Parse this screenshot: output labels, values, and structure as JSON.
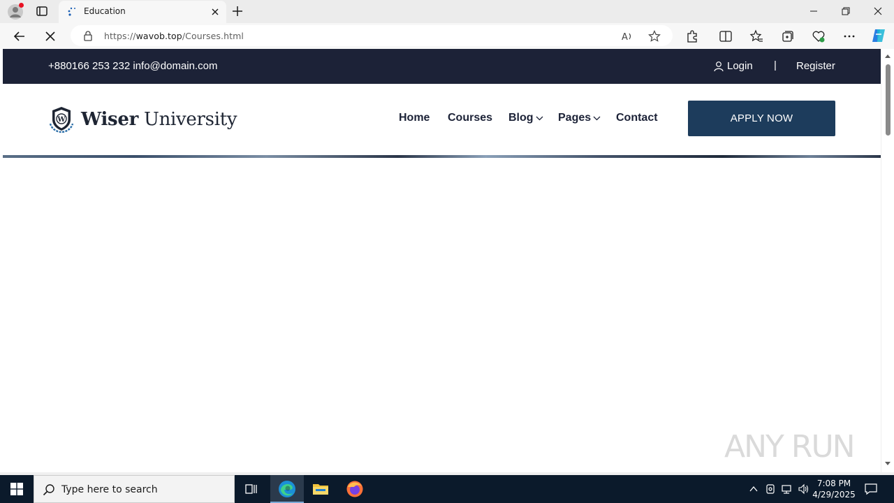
{
  "browser": {
    "tab_title": "Education",
    "url_prefix": "https://",
    "url_host": "wavob.top",
    "url_path": "/Courses.html"
  },
  "site": {
    "topbar": {
      "contact": "+880166 253 232 info@domain.com",
      "login": "Login",
      "separator": "|",
      "register": "Register"
    },
    "logo": {
      "bold": "Wiser",
      "regular": "University",
      "emblem_letter": "W"
    },
    "nav": {
      "home": "Home",
      "courses": "Courses",
      "blog": "Blog",
      "pages": "Pages",
      "contact": "Contact"
    },
    "cta": "APPLY NOW",
    "colors": {
      "topbar_bg": "#1c2237",
      "button_bg": "#1d3c5c"
    }
  },
  "watermark": "ANY RUN",
  "taskbar": {
    "search_placeholder": "Type here to search",
    "time": "7:08 PM",
    "date": "4/29/2025"
  }
}
